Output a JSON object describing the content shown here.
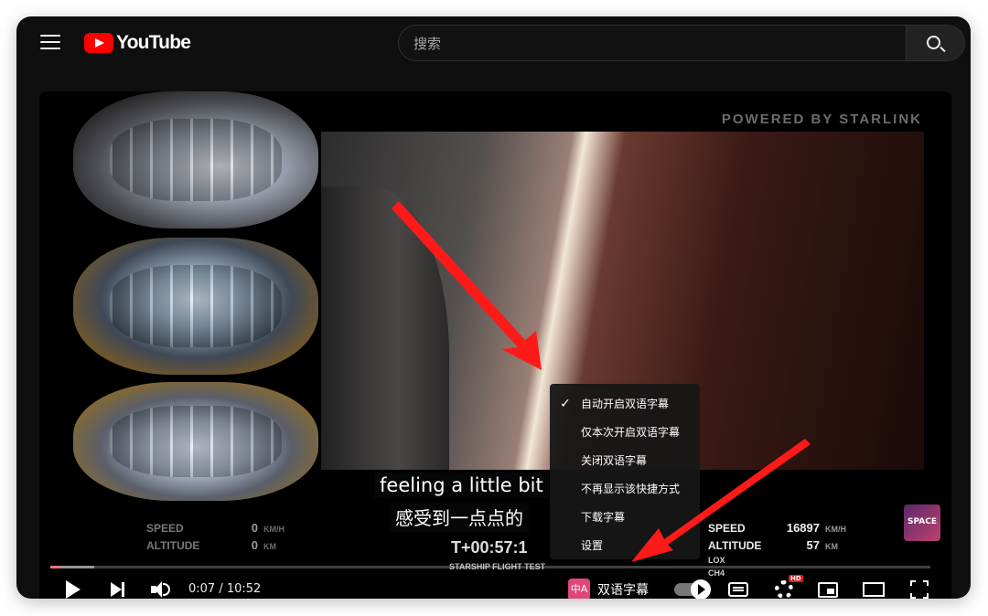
{
  "app": {
    "logo_text": "YouTube"
  },
  "search": {
    "placeholder": "搜索"
  },
  "video": {
    "watermark": "POWERED BY STARLINK",
    "telemetry_left": {
      "speed_label": "SPEED",
      "speed_value": "0",
      "speed_unit": "KM/H",
      "altitude_label": "ALTITUDE",
      "altitude_value": "0",
      "altitude_unit": "KM"
    },
    "telemetry_right": {
      "speed_label": "SPEED",
      "speed_value": "16897",
      "speed_unit": "KM/H",
      "altitude_label": "ALTITUDE",
      "altitude_value": "57",
      "altitude_unit": "KM",
      "lox_label": "LOX",
      "ch4_label": "CH4"
    },
    "timer": "T+00:57:1",
    "timer_sub": "STARSHIP FLIGHT TEST",
    "badge_text": "SPACE"
  },
  "subtitles": {
    "en": "feeling a little bit",
    "zh": "感受到一点点的"
  },
  "bilingual_menu": {
    "items": [
      {
        "label": "自动开启双语字幕",
        "checked": true
      },
      {
        "label": "仅本次开启双语字幕",
        "checked": false
      },
      {
        "label": "关闭双语字幕",
        "checked": false
      },
      {
        "label": "不再显示该快捷方式",
        "checked": false
      },
      {
        "label": "下载字幕",
        "checked": false
      },
      {
        "label": "设置",
        "checked": false
      }
    ],
    "check_glyph": "✓"
  },
  "controls": {
    "time": "0:07 / 10:52",
    "progress_fraction": 0.011,
    "bilingual_icon_text": "中A",
    "bilingual_label": "双语字幕",
    "hd_badge": "HD"
  },
  "colors": {
    "accent": "#ff0000",
    "bilingual": "#e0457b",
    "annotation_arrow": "#ff1a1a"
  }
}
